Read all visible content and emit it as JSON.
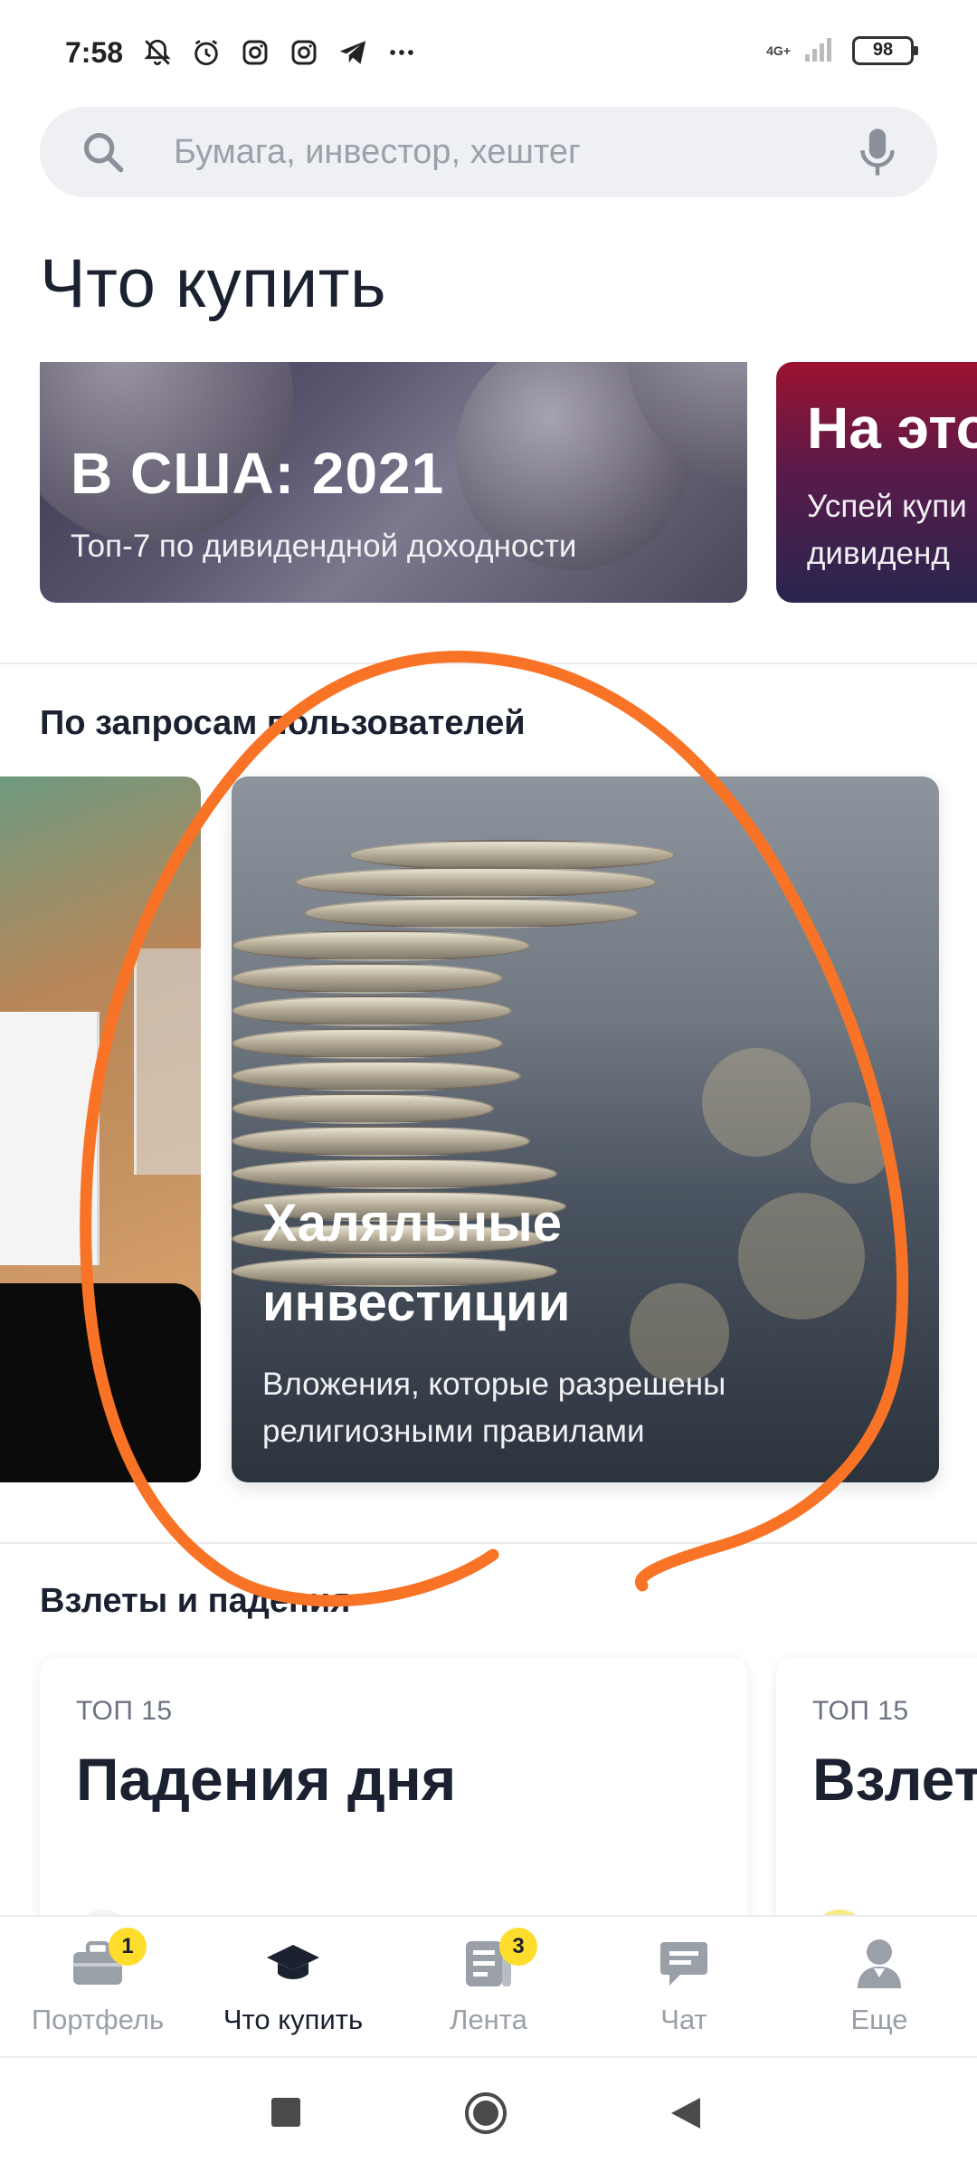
{
  "status_bar": {
    "time": "7:58",
    "icons": [
      "bell-off-icon",
      "alarm-icon",
      "instagram-icon",
      "instagram-icon",
      "telegram-icon",
      "more-dots-icon"
    ],
    "network": "4G+",
    "battery": "98"
  },
  "search": {
    "placeholder": "Бумага, инвестор, хештег"
  },
  "page_title": "Что купить",
  "top_cards": [
    {
      "title": "В США: 2021",
      "subtitle": "Топ-7 по дивидендной доходности"
    },
    {
      "title": "На это",
      "subtitle_line1": "Успей купи",
      "subtitle_line2": "дивиденд"
    }
  ],
  "requests_section": {
    "title": "По запросам пользователей",
    "main_card": {
      "title_line1": "Халяльные",
      "title_line2": "инвестиции",
      "subtitle_line1": "Вложения, которые разрешены",
      "subtitle_line2": "религиозными правилами"
    }
  },
  "movers_section": {
    "title": "Взлеты и падения",
    "cards": [
      {
        "tag": "ТОП 15",
        "title": "Падения дня"
      },
      {
        "tag": "ТОП 15",
        "title": "Взлет"
      }
    ]
  },
  "bottom_nav": [
    {
      "label": "Портфель",
      "icon": "briefcase-icon",
      "badge": "1",
      "active": false
    },
    {
      "label": "Что купить",
      "icon": "graduation-cap-icon",
      "badge": "",
      "active": true
    },
    {
      "label": "Лента",
      "icon": "news-feed-icon",
      "badge": "3",
      "active": false
    },
    {
      "label": "Чат",
      "icon": "chat-icon",
      "badge": "",
      "active": false
    },
    {
      "label": "Еще",
      "icon": "profile-icon",
      "badge": "",
      "active": false
    }
  ],
  "colors": {
    "accent_badge": "#ffdd2d",
    "annotation_stroke": "#f97326",
    "text_primary": "#1b2130",
    "text_muted": "#9aa0a8"
  }
}
